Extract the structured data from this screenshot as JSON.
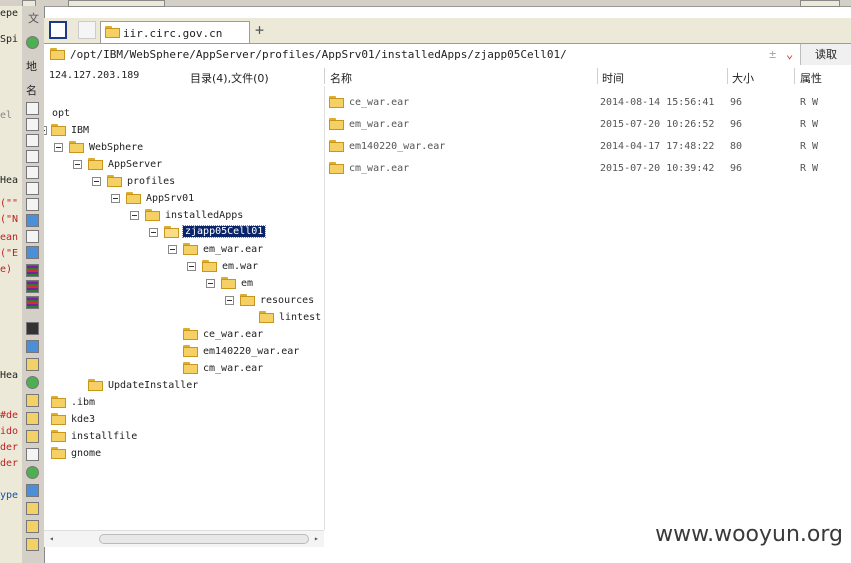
{
  "left_fragments": [
    "epe",
    "Spi",
    "el",
    "Hea",
    "(\"\"",
    "(\"N",
    "ean",
    "(\"E",
    "e)",
    "Hea",
    "#de",
    "ido",
    "der",
    "der",
    "ype"
  ],
  "left_chars": {
    "wen": "文",
    "di": "地",
    "ming": "名"
  },
  "tab": {
    "title": "iir.circ.gov.cn",
    "add": "+"
  },
  "address": {
    "path": "/opt/IBM/WebSphere/AppServer/profiles/AppSrv01/installedApps/zjapp05Cell01/",
    "read_label": "读取",
    "dd_a": "±",
    "dd_b": "⌄"
  },
  "status": {
    "ip": "124.127.203.189",
    "summary": "目录(4),文件(0)"
  },
  "columns": {
    "name": "名称",
    "time": "时间",
    "size": "大小",
    "attr": "属性"
  },
  "tree": [
    {
      "label": "opt"
    },
    {
      "label": "IBM"
    },
    {
      "label": "WebSphere"
    },
    {
      "label": "AppServer"
    },
    {
      "label": "profiles"
    },
    {
      "label": "AppSrv01"
    },
    {
      "label": "installedApps"
    },
    {
      "label": "zjapp05Cell01",
      "selected": true
    },
    {
      "label": "em_war.ear"
    },
    {
      "label": "em.war"
    },
    {
      "label": "em"
    },
    {
      "label": "resources"
    },
    {
      "label": "lintest"
    },
    {
      "label": "ce_war.ear"
    },
    {
      "label": "em140220_war.ear"
    },
    {
      "label": "cm_war.ear"
    },
    {
      "label": "UpdateInstaller"
    },
    {
      "label": ".ibm"
    },
    {
      "label": "kde3"
    },
    {
      "label": "installfile"
    },
    {
      "label": "gnome"
    }
  ],
  "files": [
    {
      "name": "ce_war.ear",
      "time": "2014-08-14 15:56:41",
      "size": "96",
      "attr": "R W"
    },
    {
      "name": "em_war.ear",
      "time": "2015-07-20 10:26:52",
      "size": "96",
      "attr": "R W"
    },
    {
      "name": "em140220_war.ear",
      "time": "2014-04-17 17:48:22",
      "size": "80",
      "attr": "R W"
    },
    {
      "name": "cm_war.ear",
      "time": "2015-07-20 10:39:42",
      "size": "96",
      "attr": "R W"
    }
  ],
  "watermark": "www.wooyun.org"
}
